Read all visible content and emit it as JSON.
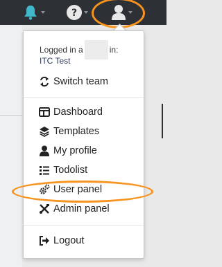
{
  "topbar": {
    "icons": [
      "bell-icon",
      "help-icon",
      "user-icon"
    ],
    "bell_color": "#3fb8c9",
    "icon_color": "#e8e8e8"
  },
  "menu": {
    "logged_in_prefix": "Logged in a",
    "logged_in_suffix": "in:",
    "team_name": "ITC Test",
    "switch_team": "Switch team",
    "items": [
      {
        "label": "Dashboard",
        "icon": "dashboard-icon"
      },
      {
        "label": "Templates",
        "icon": "layers-icon"
      },
      {
        "label": "My profile",
        "icon": "user-icon"
      },
      {
        "label": "Todolist",
        "icon": "list-icon"
      },
      {
        "label": "User panel",
        "icon": "cogs-icon"
      },
      {
        "label": "Admin panel",
        "icon": "tools-icon"
      }
    ],
    "logout": "Logout"
  },
  "annotation_color": "#f7931e"
}
